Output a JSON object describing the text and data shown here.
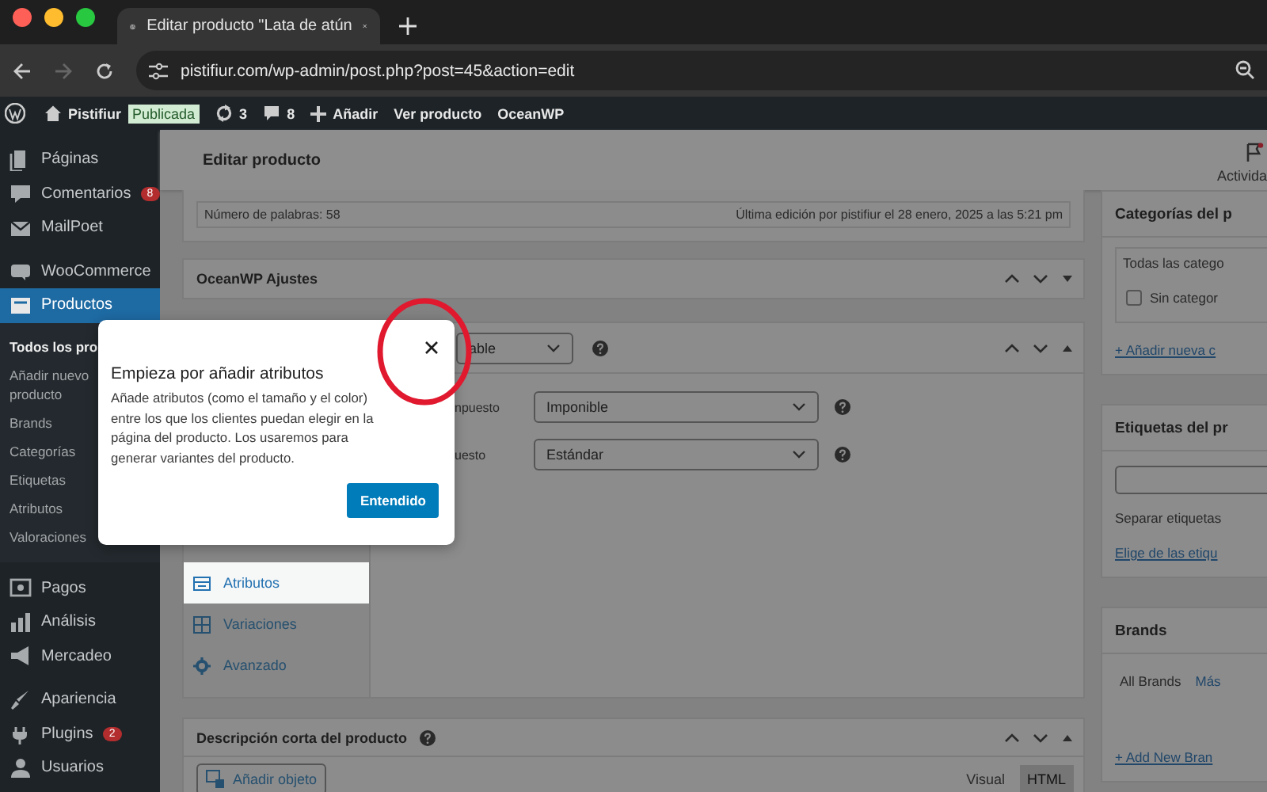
{
  "browser": {
    "tab_title": "Editar producto \"Lata de atún",
    "url": "pistifiur.com/wp-admin/post.php?post=45&action=edit"
  },
  "admin_bar": {
    "site": "Pistifiur",
    "status_badge": "Publicada",
    "updates": "3",
    "comments": "8",
    "new": "Añadir",
    "view": "Ver producto",
    "theme": "OceanWP"
  },
  "sidebar": {
    "groups": [
      [
        {
          "label": "Páginas",
          "selected": false
        },
        {
          "label": "Comentarios",
          "badge": "8",
          "selected": false
        },
        {
          "label": "MailPoet",
          "selected": false
        }
      ],
      [
        {
          "label": "WooCommerce",
          "selected": false
        },
        {
          "label": "Productos",
          "selected": true,
          "children": [
            {
              "label": "Todos los pro",
              "selected": true
            },
            {
              "label": "Añadir nuevo producto",
              "selected": false
            },
            {
              "label": "Brands",
              "selected": false
            },
            {
              "label": "Categorías",
              "selected": false
            },
            {
              "label": "Etiquetas",
              "selected": false
            },
            {
              "label": "Atributos",
              "selected": false
            },
            {
              "label": "Valoraciones",
              "selected": false
            }
          ]
        }
      ],
      [
        {
          "label": "Pagos",
          "selected": false
        },
        {
          "label": "Análisis",
          "selected": false
        },
        {
          "label": "Mercadeo",
          "selected": false
        }
      ],
      [
        {
          "label": "Apariencia",
          "selected": false
        },
        {
          "label": "Plugins",
          "badge": "2",
          "selected": false
        },
        {
          "label": "Usuarios",
          "selected": false
        }
      ]
    ]
  },
  "page_header": {
    "title": "Editar producto",
    "activity": "Activida"
  },
  "word_count": "Número de palabras: 58",
  "last_edit": "Última edición por pistifiur el 28 enero, 2025 a las 5:21 pm",
  "oceanwp_panel": {
    "title": "OceanWP Ajustes"
  },
  "product_data": {
    "type_value": "able",
    "rows": [
      {
        "label": "npuesto",
        "value": "Imponible"
      },
      {
        "label": "uesto",
        "value": "Estándar"
      }
    ],
    "tabs": [
      {
        "label": "Atributos",
        "selected": true
      },
      {
        "label": "Variaciones",
        "selected": false
      },
      {
        "label": "Avanzado",
        "selected": false
      }
    ]
  },
  "short_description": {
    "title": "Descripción corta del producto",
    "add_media": "Añadir objeto",
    "editor_tabs": [
      {
        "label": "Visual",
        "selected": false
      },
      {
        "label": "HTML",
        "selected": true
      }
    ]
  },
  "categories_panel": {
    "title": "Categorías del p",
    "tab": "Todas las catego",
    "checkbox": {
      "label": "Sin categor",
      "checked": false
    },
    "link": "+ Añadir nueva c"
  },
  "tags_panel": {
    "title": "Etiquetas del pr",
    "hint": "Separar etiquetas",
    "link": "Elige de las etiqu"
  },
  "brands_panel": {
    "title": "Brands",
    "tabs": [
      {
        "label": "All Brands",
        "selected": true
      },
      {
        "label": "Más",
        "selected": false
      }
    ],
    "link": "+ Add New Bran"
  },
  "tour": {
    "title": "Empieza por añadir atributos",
    "body": "Añade atributos (como el tamaño y el color) entre los que los clientes puedan elegir en la página del producto. Los usaremos para generar variantes del producto.",
    "button": "Entendido"
  }
}
